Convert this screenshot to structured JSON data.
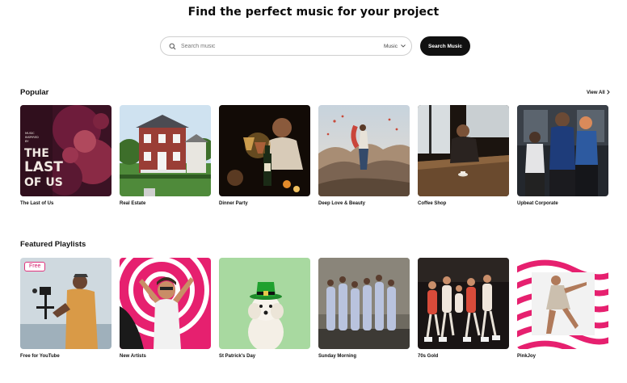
{
  "header": {
    "title": "Find the perfect music for your project"
  },
  "search": {
    "placeholder": "Search music",
    "category": "Music",
    "button_label": "Search Music"
  },
  "popular": {
    "title": "Popular",
    "view_all": "View All",
    "items": [
      {
        "label": "The Last of Us",
        "cover_text": [
          "MUSIC",
          "INSPIRED",
          "BY",
          "THE",
          "LAST",
          "OF US"
        ]
      },
      {
        "label": "Real Estate"
      },
      {
        "label": "Dinner Party"
      },
      {
        "label": "Deep Love & Beauty"
      },
      {
        "label": "Coffee Shop"
      },
      {
        "label": "Upbeat Corporate"
      }
    ]
  },
  "featured": {
    "title": "Featured Playlists",
    "items": [
      {
        "label": "Free for YouTube",
        "badge": "Free"
      },
      {
        "label": "New Artists"
      },
      {
        "label": "St Patrick's Day"
      },
      {
        "label": "Sunday Morning"
      },
      {
        "label": "70s Gold"
      },
      {
        "label": "PinkJoy"
      }
    ]
  },
  "colors": {
    "accent_pink": "#e6206f",
    "button_bg": "#111111",
    "st_patrick_bg": "#a8d9a0"
  }
}
